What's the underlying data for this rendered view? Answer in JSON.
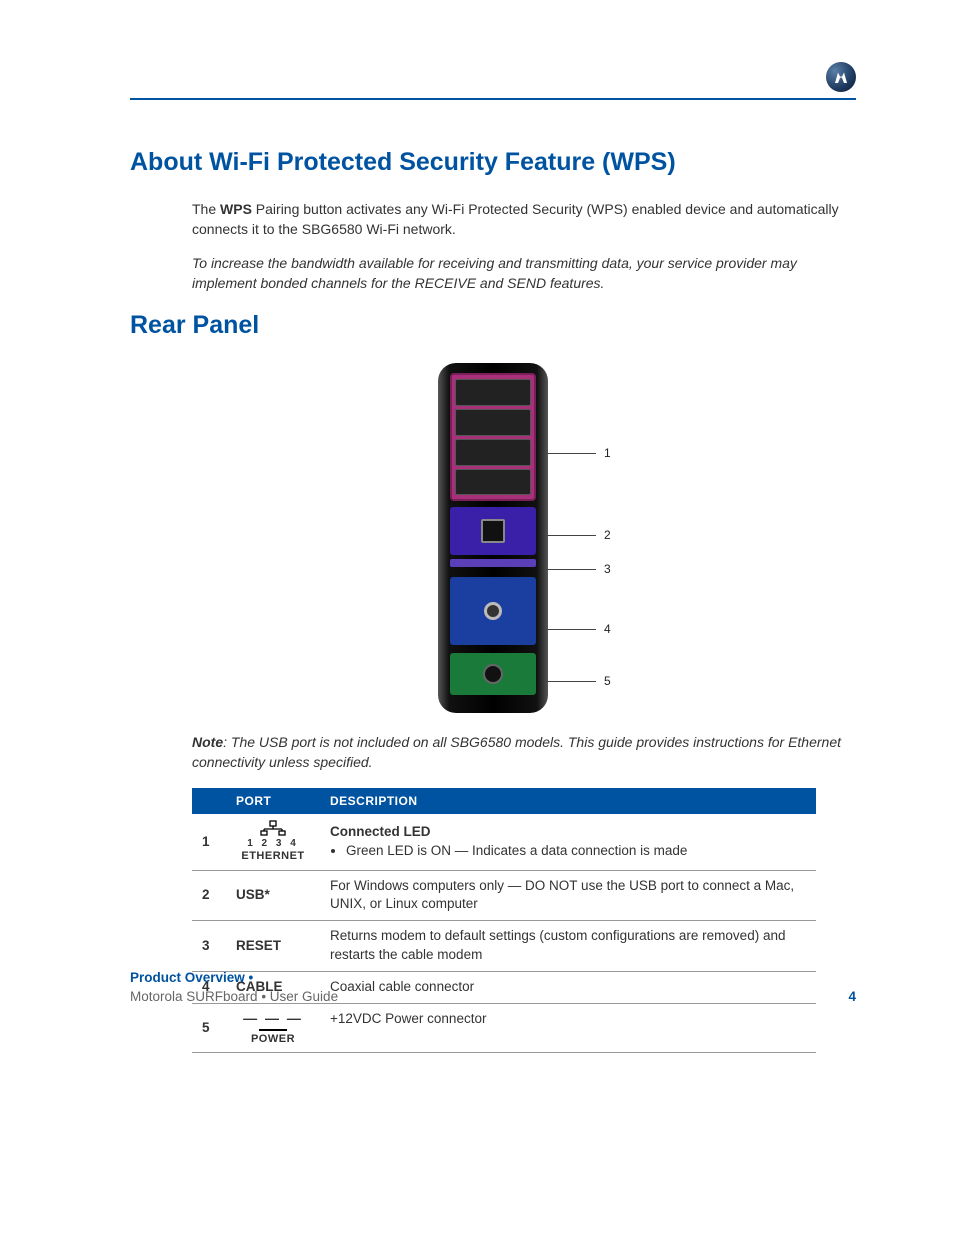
{
  "logo_name": "motorola-logo",
  "headings": {
    "wps": "About Wi-Fi Protected Security Feature (WPS)",
    "rear_panel": "Rear Panel"
  },
  "wps_para": {
    "pre": "The ",
    "bold": "WPS",
    "post": " Pairing button activates any Wi-Fi Protected Security (WPS) enabled device and automatically connects it to the SBG6580 Wi-Fi network."
  },
  "bandwidth_note": "To increase the bandwidth available for receiving and transmitting data, your service provider may implement bonded channels for the RECEIVE and SEND features.",
  "callouts": [
    "1",
    "2",
    "3",
    "4",
    "5"
  ],
  "usb_note": {
    "label": "Note",
    "text": ": The USB port is not included on all SBG6580 models. This guide provides instructions for Ethernet connectivity unless specified."
  },
  "table": {
    "headers": {
      "blank": "",
      "port": "PORT",
      "description": "DESCRIPTION"
    },
    "rows": [
      {
        "num": "1",
        "port_type": "ethernet_icon",
        "eth_nums": "1 2 3 4",
        "eth_label": "ETHERNET",
        "desc_title": "Connected LED",
        "desc_bullet": "Green LED is ON — Indicates a data connection is made"
      },
      {
        "num": "2",
        "port_label": "USB*",
        "desc": "For Windows computers only — DO NOT use the USB port to connect a Mac, UNIX, or Linux computer"
      },
      {
        "num": "3",
        "port_label": "RESET",
        "desc": "Returns modem to default settings (custom configurations are removed) and restarts the cable modem"
      },
      {
        "num": "4",
        "port_label": "CABLE",
        "desc": "Coaxial cable connector"
      },
      {
        "num": "5",
        "port_type": "power_icon",
        "pwr_dash": "— — —",
        "pwr_label": "POWER",
        "desc": "+12VDC Power connector"
      }
    ]
  },
  "footer": {
    "section": "Product Overview",
    "dot": " • ",
    "guide_pre": "Motorola SURFboard ",
    "guide_dot": "•",
    "guide_post": " User Guide",
    "page_num": "4"
  }
}
